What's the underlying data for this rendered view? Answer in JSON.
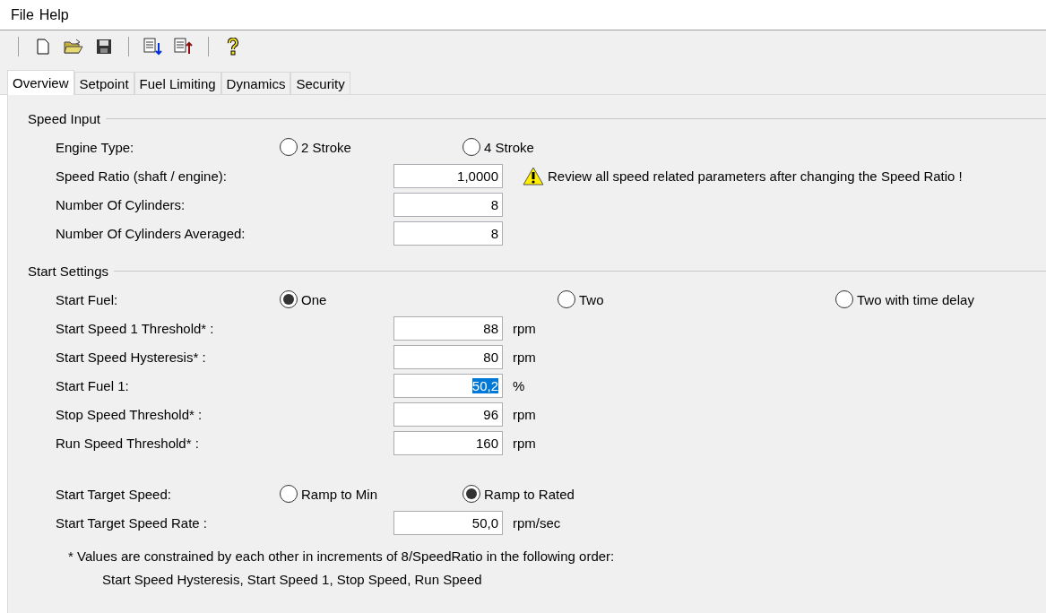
{
  "menu": [
    "File",
    "Help"
  ],
  "toolbar": [
    {
      "kind": "new"
    },
    {
      "kind": "open"
    },
    {
      "kind": "save"
    },
    {
      "kind": "separator"
    },
    {
      "kind": "download"
    },
    {
      "kind": "upload"
    },
    {
      "kind": "separator"
    },
    {
      "kind": "help"
    }
  ],
  "tabs": [
    {
      "label": "Overview",
      "selected": true
    },
    {
      "label": "Setpoint",
      "selected": false
    },
    {
      "label": "Fuel Limiting",
      "selected": false
    },
    {
      "label": "Dynamics",
      "selected": false
    },
    {
      "label": "Security",
      "selected": false
    }
  ],
  "sections": [
    {
      "title": "Speed Input",
      "rows": [
        {
          "kind": "radio",
          "label": "Engine Type:",
          "options": [
            {
              "label": "2 Stroke",
              "selected": false
            },
            {
              "label": "4 Stroke",
              "selected": false
            }
          ]
        },
        {
          "kind": "input",
          "label": "Speed Ratio (shaft / engine):",
          "value": "1,0000",
          "warning": "Review all speed related parameters after changing the Speed Ratio !"
        },
        {
          "kind": "input",
          "label": "Number Of Cylinders:",
          "value": "8"
        },
        {
          "kind": "input",
          "label": "Number Of Cylinders Averaged:",
          "value": "8"
        }
      ]
    },
    {
      "title": "Start Settings",
      "rows": [
        {
          "kind": "radio",
          "label": "Start Fuel:",
          "options": [
            {
              "label": "One",
              "selected": true
            },
            {
              "label": "Two",
              "selected": false
            },
            {
              "label": "Two with time delay",
              "selected": false
            }
          ]
        },
        {
          "kind": "input",
          "label": "Start Speed 1 Threshold* :",
          "value": "88",
          "unit": "rpm"
        },
        {
          "kind": "input",
          "label": "Start Speed Hysteresis* :",
          "value": "80",
          "unit": "rpm"
        },
        {
          "kind": "input",
          "label": "Start Fuel 1:",
          "value": "50,2",
          "unit": "%",
          "text_selected": true
        },
        {
          "kind": "input",
          "label": "Stop Speed Threshold* :",
          "value": "96",
          "unit": "rpm"
        },
        {
          "kind": "input",
          "label": "Run Speed Threshold* :",
          "value": "160",
          "unit": "rpm"
        },
        {
          "kind": "spacer"
        },
        {
          "kind": "radio",
          "label": "Start Target Speed:",
          "options": [
            {
              "label": "Ramp to Min",
              "selected": false
            },
            {
              "label": "Ramp to Rated",
              "selected": true
            }
          ]
        },
        {
          "kind": "input",
          "label": "Start Target Speed Rate :",
          "value": "50,0",
          "unit": "rpm/sec"
        },
        {
          "kind": "note",
          "text": "* Values are constrained by each other in increments of 8/SpeedRatio in the following order:"
        },
        {
          "kind": "subnote",
          "text": "Start Speed Hysteresis, Start Speed 1, Stop Speed, Run Speed"
        }
      ]
    }
  ]
}
